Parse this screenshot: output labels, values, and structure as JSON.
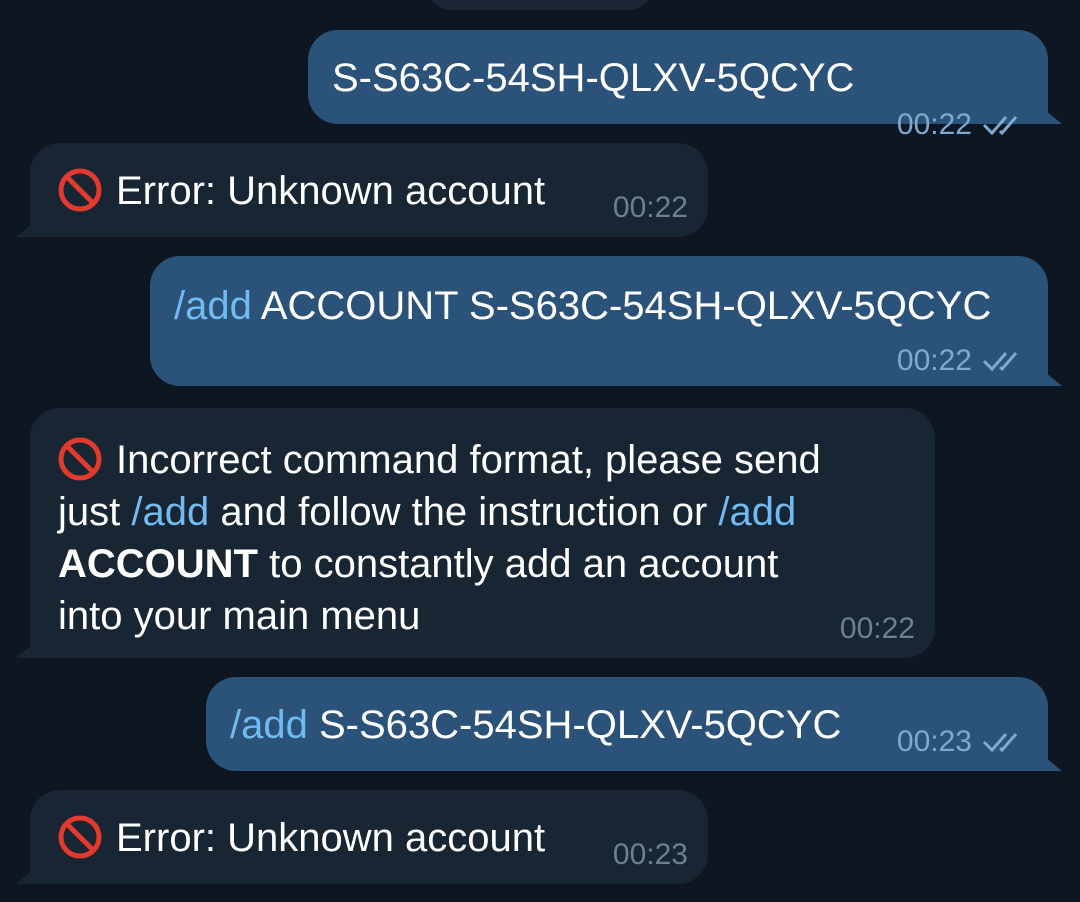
{
  "messages": [
    {
      "id": 1,
      "direction": "outgoing",
      "text": "S-S63C-54SH-QLXV-5QCYC",
      "time": "00:22",
      "status": "read"
    },
    {
      "id": 2,
      "direction": "incoming",
      "icon": "no-entry-icon",
      "text": "Error: Unknown account",
      "time": "00:22"
    },
    {
      "id": 3,
      "direction": "outgoing",
      "command": "/add",
      "text": " ACCOUNT S-S63C-54SH-QLXV-5QCYC",
      "time": "00:22",
      "status": "read"
    },
    {
      "id": 4,
      "direction": "incoming",
      "icon": "no-entry-icon",
      "line1": "Incorrect command format, please send",
      "line2_a": "just ",
      "line2_cmd1": "/add",
      "line2_b": " and follow the instruction or ",
      "line2_cmd2": "/add",
      "line3_bold": "ACCOUNT",
      "line3_rest": " to constantly add an account",
      "line4": "into your main menu",
      "time": "00:22"
    },
    {
      "id": 5,
      "direction": "outgoing",
      "command": "/add",
      "text": " S-S63C-54SH-QLXV-5QCYC",
      "time": "00:23",
      "status": "read"
    },
    {
      "id": 6,
      "direction": "incoming",
      "icon": "no-entry-icon",
      "text": "Error: Unknown account",
      "time": "00:23"
    }
  ],
  "colors": {
    "background": "#0e1621",
    "outgoing_bubble": "#2b5278",
    "incoming_bubble": "#182533",
    "command_link": "#71baf2"
  }
}
